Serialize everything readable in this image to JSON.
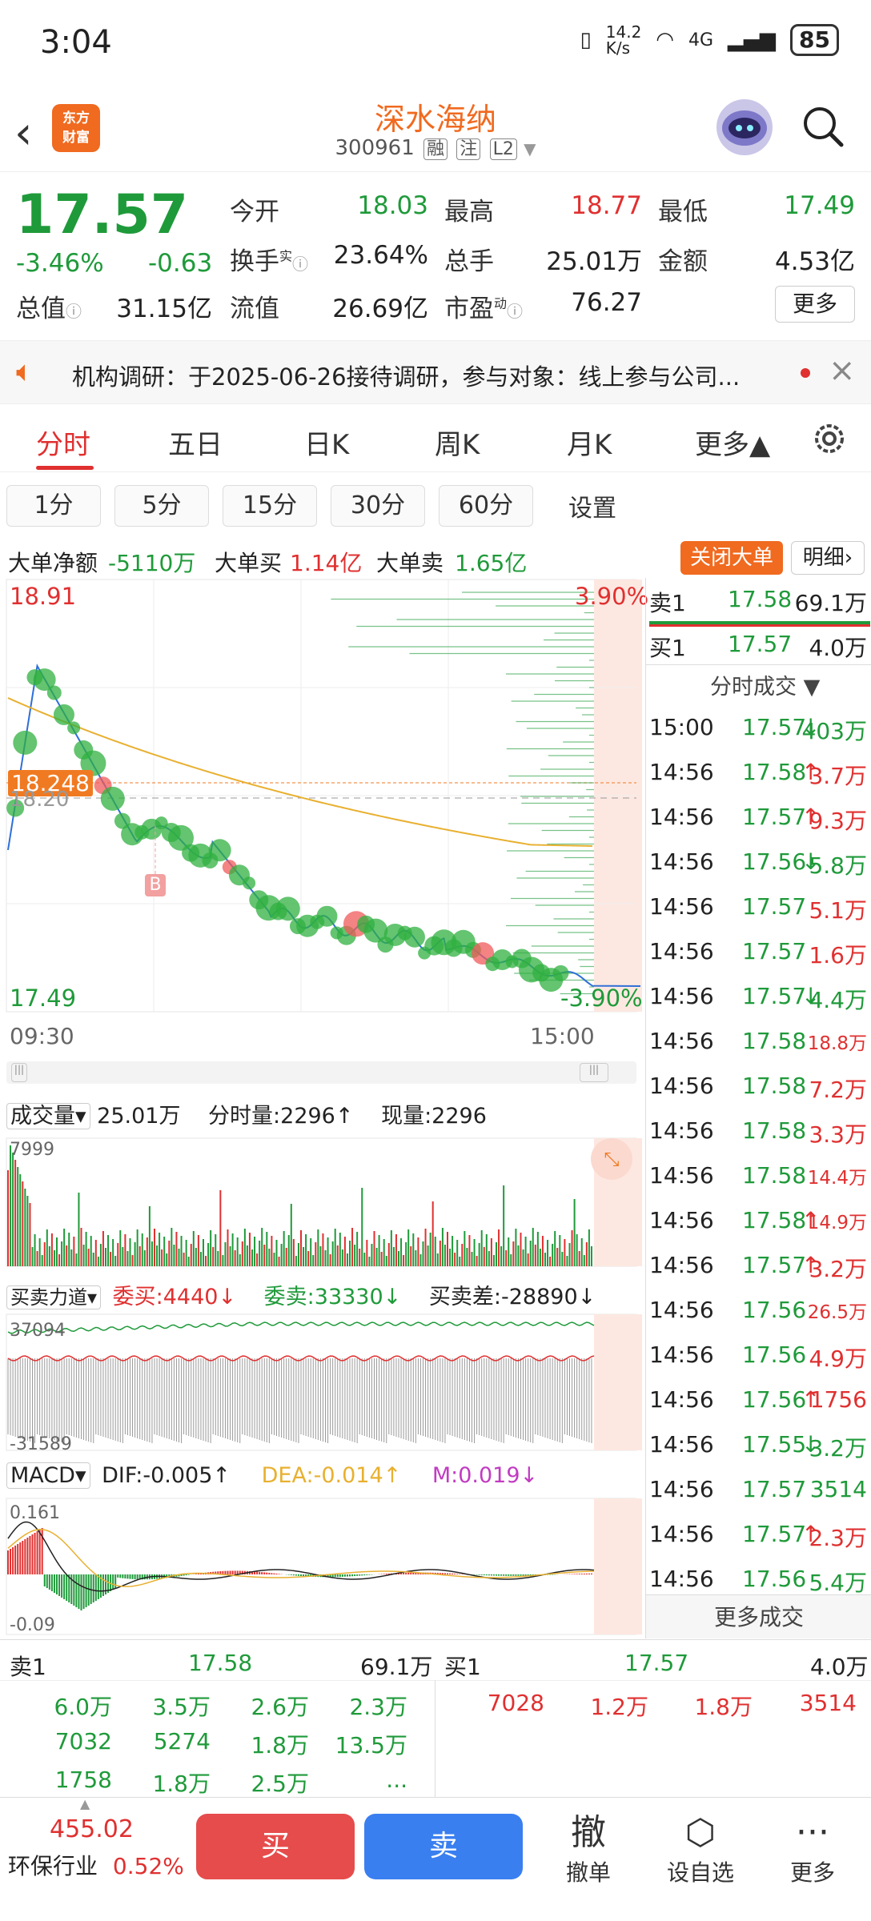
{
  "status": {
    "time": "3:04",
    "net_speed": "14.2\nK/s",
    "network": "4G",
    "battery": "85"
  },
  "header": {
    "logo_text": "东方\n财富",
    "name": "深水海纳",
    "code": "300961",
    "tags": [
      "融",
      "注",
      "L2"
    ]
  },
  "quote": {
    "price": "17.57",
    "change_pct": "-3.46%",
    "change": "-0.63",
    "fields": [
      {
        "label": "今开",
        "value": "18.03",
        "color": "green"
      },
      {
        "label": "最高",
        "value": "18.77",
        "color": "red"
      },
      {
        "label": "最低",
        "value": "17.49",
        "color": "green"
      },
      {
        "label": "换手",
        "value": "23.64%",
        "color": "dark"
      },
      {
        "label": "总手",
        "value": "25.01万",
        "color": "dark"
      },
      {
        "label": "金额",
        "value": "4.53亿",
        "color": "dark"
      },
      {
        "label": "总值",
        "value": "31.15亿",
        "color": "dark"
      },
      {
        "label": "流值",
        "value": "26.69亿",
        "color": "dark"
      },
      {
        "label": "市盈",
        "value": "76.27",
        "color": "dark"
      }
    ],
    "turnover_sup": "实",
    "pe_sup": "动",
    "more": "更多"
  },
  "notice": {
    "text": "机构调研：于2025-06-26接待调研，参与对象：线上参与公司..."
  },
  "tabs": [
    "分时",
    "五日",
    "日K",
    "周K",
    "月K",
    "更多▲"
  ],
  "periods": [
    "1分",
    "5分",
    "15分",
    "30分",
    "60分",
    "设置"
  ],
  "bigorder": {
    "net_label": "大单净额",
    "net_value": "-5110万",
    "buy_label": "大单买",
    "buy_value": "1.14亿",
    "sell_label": "大单卖",
    "sell_value": "1.65亿",
    "close_btn": "关闭大单",
    "detail_btn": "明细"
  },
  "intraday": {
    "high_label": "18.91",
    "low_label": "17.49",
    "pct_high": "3.90%",
    "pct_low": "-3.90%",
    "ref_price": "18.248",
    "mid_label": "18.20",
    "time_start": "09:30",
    "time_end": "15:00",
    "marker": "B"
  },
  "volume": {
    "label": "成交量",
    "total": "25.01万",
    "fs_label": "分时量:2296↑",
    "now_label": "现量:2296",
    "max": "7999"
  },
  "force": {
    "label": "买卖力道",
    "wb": "委买:4440↓",
    "ws": "委卖:33330↓",
    "diff": "买卖差:-28890↓",
    "max": "37094",
    "min": "-31589"
  },
  "macd": {
    "label": "MACD",
    "dif": "DIF:-0.005↑",
    "dea": "DEA:-0.014↑",
    "m": "M:0.019↓",
    "max": "0.161",
    "min": "-0.09"
  },
  "depth": {
    "sell1": {
      "label": "卖1",
      "price": "17.58",
      "vol": "69.1万"
    },
    "buy1": {
      "label": "买1",
      "price": "17.57",
      "vol": "4.0万"
    },
    "header": "分时成交 ▼"
  },
  "trades": [
    {
      "t": "15:00",
      "p": "17.57",
      "a": "↓",
      "v": "403万",
      "pc": "green",
      "vc": "green"
    },
    {
      "t": "14:56",
      "p": "17.58",
      "a": "↑",
      "v": "3.7万",
      "pc": "green",
      "vc": "red"
    },
    {
      "t": "14:56",
      "p": "17.57",
      "a": "↑",
      "v": "9.3万",
      "pc": "green",
      "vc": "red"
    },
    {
      "t": "14:56",
      "p": "17.56",
      "a": "↓",
      "v": "5.8万",
      "pc": "green",
      "vc": "green"
    },
    {
      "t": "14:56",
      "p": "17.57",
      "a": "",
      "v": "5.1万",
      "pc": "green",
      "vc": "red"
    },
    {
      "t": "14:56",
      "p": "17.57",
      "a": "",
      "v": "1.6万",
      "pc": "green",
      "vc": "red"
    },
    {
      "t": "14:56",
      "p": "17.57",
      "a": "↓",
      "v": "4.4万",
      "pc": "green",
      "vc": "green"
    },
    {
      "t": "14:56",
      "p": "17.58",
      "a": "",
      "v": "18.8万",
      "pc": "green",
      "vc": "red"
    },
    {
      "t": "14:56",
      "p": "17.58",
      "a": "",
      "v": "7.2万",
      "pc": "green",
      "vc": "red"
    },
    {
      "t": "14:56",
      "p": "17.58",
      "a": "",
      "v": "3.3万",
      "pc": "green",
      "vc": "red"
    },
    {
      "t": "14:56",
      "p": "17.58",
      "a": "",
      "v": "14.4万",
      "pc": "green",
      "vc": "red"
    },
    {
      "t": "14:56",
      "p": "17.58",
      "a": "↑",
      "v": "14.9万",
      "pc": "green",
      "vc": "red"
    },
    {
      "t": "14:56",
      "p": "17.57",
      "a": "↑",
      "v": "3.2万",
      "pc": "green",
      "vc": "red"
    },
    {
      "t": "14:56",
      "p": "17.56",
      "a": "",
      "v": "26.5万",
      "pc": "green",
      "vc": "red"
    },
    {
      "t": "14:56",
      "p": "17.56",
      "a": "",
      "v": "4.9万",
      "pc": "green",
      "vc": "red"
    },
    {
      "t": "14:56",
      "p": "17.56",
      "a": "↑",
      "v": "1756",
      "pc": "green",
      "vc": "red"
    },
    {
      "t": "14:56",
      "p": "17.55",
      "a": "↓",
      "v": "3.2万",
      "pc": "green",
      "vc": "green"
    },
    {
      "t": "14:56",
      "p": "17.57",
      "a": "",
      "v": "3514",
      "pc": "green",
      "vc": "green"
    },
    {
      "t": "14:56",
      "p": "17.57",
      "a": "↑",
      "v": "2.3万",
      "pc": "green",
      "vc": "red"
    },
    {
      "t": "14:56",
      "p": "17.56",
      "a": "",
      "v": "5.4万",
      "pc": "green",
      "vc": "green"
    }
  ],
  "more_trades": "更多成交",
  "book": {
    "sell_label": "卖1",
    "sell_price": "17.58",
    "sell_vol": "69.1万",
    "buy_label": "买1",
    "buy_price": "17.57",
    "buy_vol": "4.0万",
    "sell_queue": [
      [
        "6.0万",
        "3.5万",
        "2.6万",
        "2.3万"
      ],
      [
        "7032",
        "5274",
        "1.8万",
        "13.5万"
      ],
      [
        "1758",
        "1.8万",
        "2.5万",
        "..."
      ]
    ],
    "buy_queue": [
      [
        "7028",
        "1.2万",
        "1.8万",
        "3514"
      ]
    ]
  },
  "bottom": {
    "index_value": "455.02",
    "industry": "环保行业",
    "industry_pct": "0.52%",
    "buy": "买",
    "sell": "卖",
    "cancel_glyph": "撤",
    "cancel": "撤单",
    "watch": "设自选",
    "more": "更多"
  },
  "colors": {
    "up": "#e03030",
    "down": "#1f9a3a",
    "brand": "#f06a1f",
    "buy_btn": "#e64c4c",
    "sell_btn": "#3a7ff0",
    "avg_line": "#e8b030",
    "price_line": "#2e6fd8"
  }
}
